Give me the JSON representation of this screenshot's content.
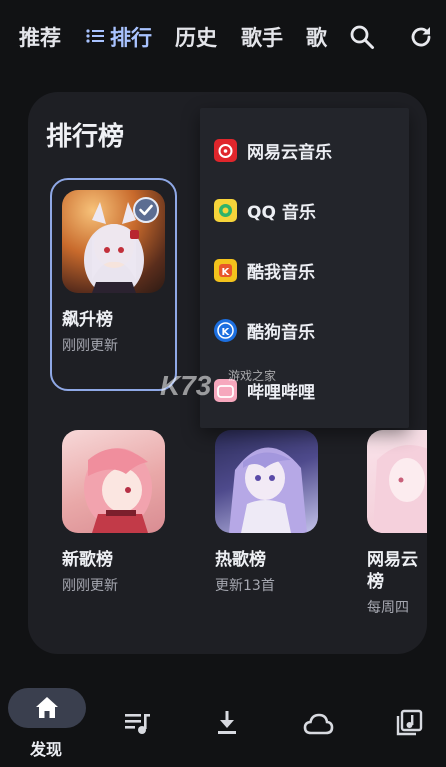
{
  "top_tabs": [
    {
      "label": "推荐"
    },
    {
      "label": "排行"
    },
    {
      "label": "历史"
    },
    {
      "label": "歌手"
    },
    {
      "label": "歌"
    }
  ],
  "card": {
    "title": "排行榜",
    "charts": [
      {
        "name": "飙升榜",
        "sub": "刚刚更新",
        "selected": true
      },
      {
        "name": "新歌榜",
        "sub": "刚刚更新"
      },
      {
        "name": "热歌榜",
        "sub": "更新13首"
      },
      {
        "name": "网易云\n榜",
        "name_line1": "网易云",
        "name_line2": "榜",
        "sub": "每周四"
      }
    ]
  },
  "source_menu": {
    "items": [
      {
        "label": "网易云音乐",
        "icon": "netease-music-icon",
        "color": "#e0262c"
      },
      {
        "label": "QQ 音乐",
        "icon": "qq-music-icon",
        "color": "#f6d43a"
      },
      {
        "label": "酷我音乐",
        "icon": "kuwo-music-icon",
        "color": "#f3c21c"
      },
      {
        "label": "酷狗音乐",
        "icon": "kugou-music-icon",
        "color": "#1c6fe0"
      },
      {
        "label": "哔哩哔哩",
        "icon": "bilibili-icon",
        "color": "#f6a7bd"
      }
    ]
  },
  "watermark": {
    "logo": "K73",
    "text": "游戏之家"
  },
  "bottom_nav": {
    "active_label": "发现",
    "items": [
      "home-icon",
      "playlist-icon",
      "download-icon",
      "cloud-icon",
      "library-icon"
    ]
  },
  "colors": {
    "accent": "#a9c3ff",
    "card_bg": "#1e1f24",
    "menu_bg": "#23252b",
    "selected_border": "#8fa8e6"
  }
}
